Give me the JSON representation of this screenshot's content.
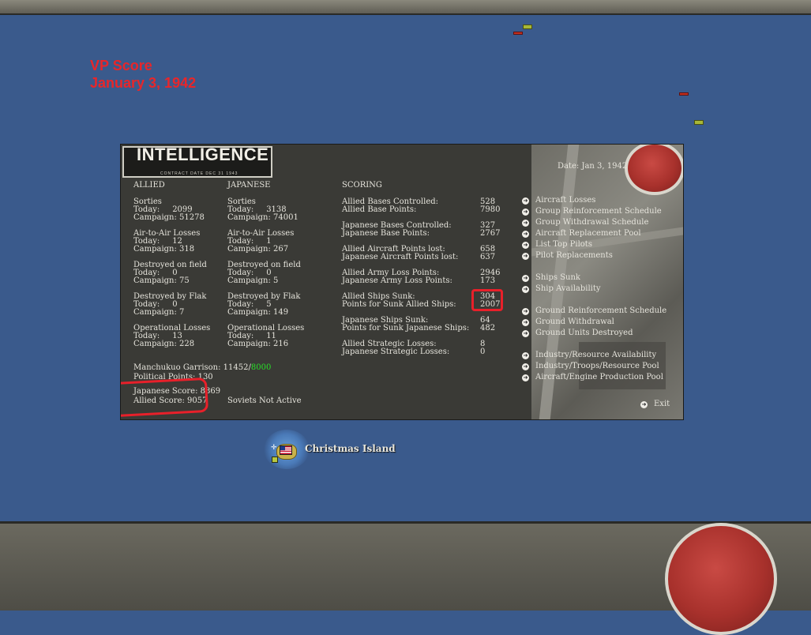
{
  "vp": {
    "title": "VP Score",
    "date": "January 3, 1942"
  },
  "panel": {
    "logo": "INTELLIGENCE",
    "logo_sub": "CONTRACT DATE DEC 31 1943",
    "date": "Date: Jan 3, 1942",
    "allied": {
      "header": "ALLIED",
      "sorties": [
        "Sorties",
        "Today:     2099",
        "Campaign: 51278"
      ],
      "a2a": [
        "Air-to-Air Losses",
        "Today:     12",
        "Campaign: 318"
      ],
      "dof": [
        "Destroyed on field",
        "Today:     0",
        "Campaign: 75"
      ],
      "flak": [
        "Destroyed by Flak",
        "Today:     0",
        "Campaign: 7"
      ],
      "ops": [
        "Operational Losses",
        "Today:     13",
        "Campaign: 228"
      ]
    },
    "japanese": {
      "header": "JAPANESE",
      "sorties": [
        "Sorties",
        "Today:     3138",
        "Campaign: 74001"
      ],
      "a2a": [
        "Air-to-Air Losses",
        "Today:     1",
        "Campaign: 267"
      ],
      "dof": [
        "Destroyed on field",
        "Today:     0",
        "Campaign: 5"
      ],
      "flak": [
        "Destroyed by Flak",
        "Today:     5",
        "Campaign: 149"
      ],
      "ops": [
        "Operational Losses",
        "Today:     11",
        "Campaign: 216"
      ]
    },
    "garrison_label": "Manchukuo Garrison: 11452/",
    "garrison_req": "8000",
    "political": "Political Points: 130",
    "japanese_score": "Japanese Score: 8869",
    "allied_score": "Allied Score: 9057",
    "soviets": "Soviets Not Active",
    "scoring": {
      "header": "SCORING",
      "rows": [
        [
          "Allied Bases Controlled:",
          "528"
        ],
        [
          "Allied Base Points:",
          "7980"
        ],
        [
          "Japanese Bases Controlled:",
          "327"
        ],
        [
          "Japanese Base Points:",
          "2767"
        ],
        [
          "Allied Aircraft Points lost:",
          "658"
        ],
        [
          "Japanese Aircraft Points lost:",
          "637"
        ],
        [
          "Allied Army Loss Points:",
          "2946"
        ],
        [
          "Japanese Army Loss Points:",
          "173"
        ],
        [
          "Allied Ships Sunk:",
          "304"
        ],
        [
          "Points for Sunk Allied Ships:",
          "2007"
        ],
        [
          "Japanese Ships Sunk:",
          "64"
        ],
        [
          "Points for Sunk Japanese Ships:",
          "482"
        ],
        [
          "Allied Strategic Losses:",
          "8"
        ],
        [
          "Japanese Strategic Losses:",
          "0"
        ]
      ]
    },
    "links": [
      "Aircraft Losses",
      "Group Reinforcement Schedule",
      "Group Withdrawal Schedule",
      "Aircraft Replacement Pool",
      "List Top Pilots",
      "Pilot Replacements",
      "Ships Sunk",
      "Ship Availability",
      "Ground Reinforcement Schedule",
      "Ground Withdrawal",
      "Ground Units Destroyed",
      "Industry/Resource Availability",
      "Industry/Troops/Resource Pool",
      "Aircraft/Engine Production Pool"
    ],
    "exit": "Exit"
  },
  "map": {
    "island_name": "Christmas Island"
  },
  "colors": {
    "highlight": "#e8202a",
    "vp_text": "#e8262a",
    "garrison_req": "#28e028",
    "ocean": "#3a5a8c"
  }
}
